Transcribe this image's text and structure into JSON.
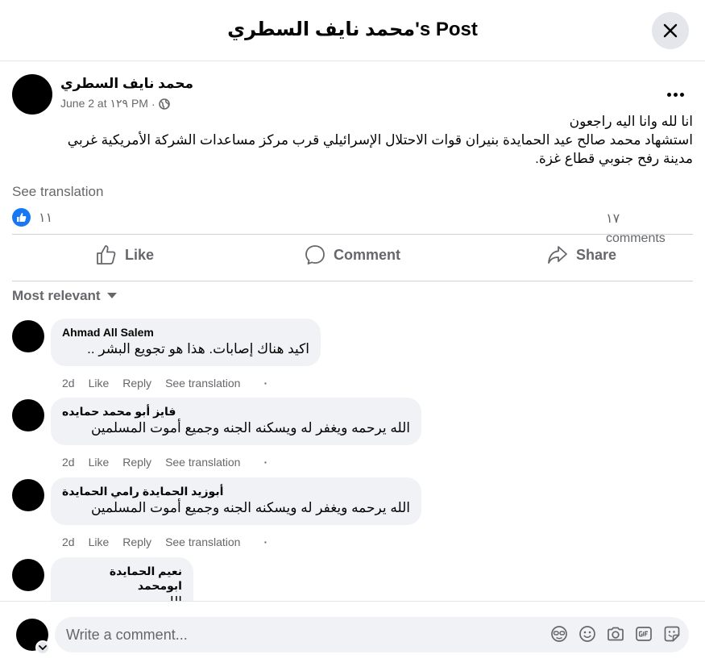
{
  "header": {
    "title": "محمد نايف السطري's Post"
  },
  "post": {
    "author": "محمد نايف السطري",
    "time": "June 2 at ١٢٩ PM",
    "separator": "·",
    "lines": [
      "انا لله وانا اليه راجعون",
      "استشهاد محمد صالح عيد الحمايدة  بنيران قوات الاحتلال الإسرائيلي قرب مركز مساعدات الشركة الأمريكية غربي",
      "مدينة رفح جنوبي قطاع غزة."
    ],
    "see_translation": "See translation",
    "likes": "١١",
    "comments_count": "١٧",
    "comments_word": "comments"
  },
  "actions": {
    "like": "Like",
    "comment": "Comment",
    "share": "Share"
  },
  "sort_label": "Most relevant",
  "comments": [
    {
      "name": "Ahmad All Salem",
      "text": "اكيد هناك إصابات. هذا هو تجويع البشر ..",
      "time": "2d",
      "like": "Like",
      "reply": "Reply",
      "translate": "See translation",
      "dot": "·"
    },
    {
      "name": "فايز أبو محمد حمايده",
      "text": "الله يرحمه ويغفر له ويسكنه الجنه وجميع أموت المسلمين",
      "time": "2d",
      "like": "Like",
      "reply": "Reply",
      "translate": "See translation",
      "dot": "·"
    },
    {
      "name": "أبوزيد الحمايدة رامي الحمايدة",
      "text": "الله يرحمه ويغفر له ويسكنه الجنه وجميع أموت المسلمين",
      "time": "2d",
      "like": "Like",
      "reply": "Reply",
      "translate": "See translation",
      "dot": "·"
    },
    {
      "name": "نعيم الحمايدة ابومحمد",
      "text": "الله يرحمه"
    }
  ],
  "composer": {
    "placeholder": "Write a comment..."
  },
  "icons": {
    "close": "close-icon",
    "globe": "globe-icon",
    "more": "more-icon",
    "like_badge": "thumbs-up-icon",
    "like": "thumbs-up-outline-icon",
    "comment": "comment-bubble-icon",
    "share": "share-arrow-icon",
    "sort": "caret-down-icon",
    "avatar_sticker": "avatar-sticker-icon",
    "emoji": "emoji-icon",
    "camera": "camera-icon",
    "gif": "gif-icon",
    "sticker": "sticker-icon",
    "chevron": "chevron-down-icon"
  }
}
